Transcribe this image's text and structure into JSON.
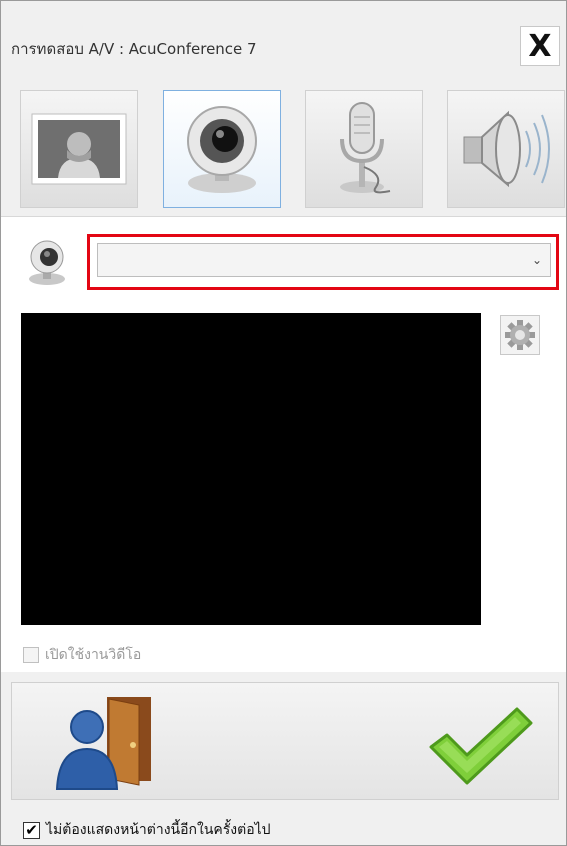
{
  "window": {
    "title": "การทดสอบ A/V : AcuConference 7",
    "close_label": "X"
  },
  "tabs": [
    {
      "name": "display",
      "icon": "person-portrait-icon",
      "active": false
    },
    {
      "name": "webcam",
      "icon": "webcam-icon",
      "active": true
    },
    {
      "name": "microphone",
      "icon": "microphone-icon",
      "active": false
    },
    {
      "name": "speaker",
      "icon": "speaker-icon",
      "active": false
    }
  ],
  "camera": {
    "device_icon": "webcam-small-icon",
    "selected_device": "",
    "chevron": "⌄"
  },
  "enable_video": {
    "label": "เปิดใช้งานวิดีโอ",
    "checked": false
  },
  "actions": {
    "exit_icon": "exit-door-icon",
    "ok_icon": "checkmark-icon"
  },
  "dont_show": {
    "label": "ไม่ต้องแสดงหน้าต่างนี้อีกในครั้งต่อไป",
    "checked": true,
    "check_glyph": "✔"
  }
}
